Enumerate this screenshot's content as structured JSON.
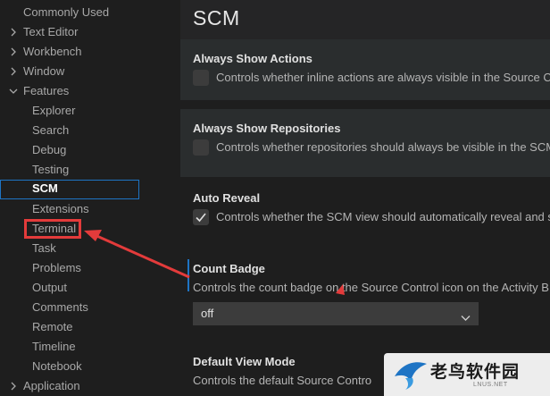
{
  "tree": {
    "items": [
      {
        "label": "Commonly Used",
        "expandable": false
      },
      {
        "label": "Text Editor",
        "expandable": true,
        "expanded": false
      },
      {
        "label": "Workbench",
        "expandable": true,
        "expanded": false
      },
      {
        "label": "Window",
        "expandable": true,
        "expanded": false
      },
      {
        "label": "Features",
        "expandable": true,
        "expanded": true
      },
      {
        "label": "Explorer"
      },
      {
        "label": "Search"
      },
      {
        "label": "Debug"
      },
      {
        "label": "Testing"
      },
      {
        "label": "SCM",
        "selected": true
      },
      {
        "label": "Extensions"
      },
      {
        "label": "Terminal",
        "annotated": true
      },
      {
        "label": "Task"
      },
      {
        "label": "Problems"
      },
      {
        "label": "Output"
      },
      {
        "label": "Comments"
      },
      {
        "label": "Remote"
      },
      {
        "label": "Timeline"
      },
      {
        "label": "Notebook"
      },
      {
        "label": "Application",
        "expandable": true,
        "expanded": false
      }
    ]
  },
  "section": {
    "title": "SCM"
  },
  "settings": {
    "always_show_actions": {
      "title": "Always Show Actions",
      "description": "Controls whether inline actions are always visible in the Source Co",
      "checked": false
    },
    "always_show_repositories": {
      "title": "Always Show Repositories",
      "description": "Controls whether repositories should always be visible in the SCM",
      "checked": false
    },
    "auto_reveal": {
      "title": "Auto Reveal",
      "description": "Controls whether the SCM view should automatically reveal and s",
      "checked": true
    },
    "count_badge": {
      "title": "Count Badge",
      "description": "Controls the count badge on the Source Control icon on the Activity B",
      "value": "off"
    },
    "default_view_mode": {
      "title": "Default View Mode",
      "description": "Controls the default Source Contro"
    }
  },
  "watermark": {
    "brand": "老鸟软件园",
    "sub": "LNUS.NET"
  },
  "colors": {
    "background": "#1e1e1e",
    "accent": "#1e74c4",
    "annotation": "#e33b3b"
  },
  "icons": {
    "collapsed": "chevron-right-icon",
    "expanded": "chevron-down-icon",
    "check": "check-icon",
    "dropdown": "chevron-down-icon"
  }
}
